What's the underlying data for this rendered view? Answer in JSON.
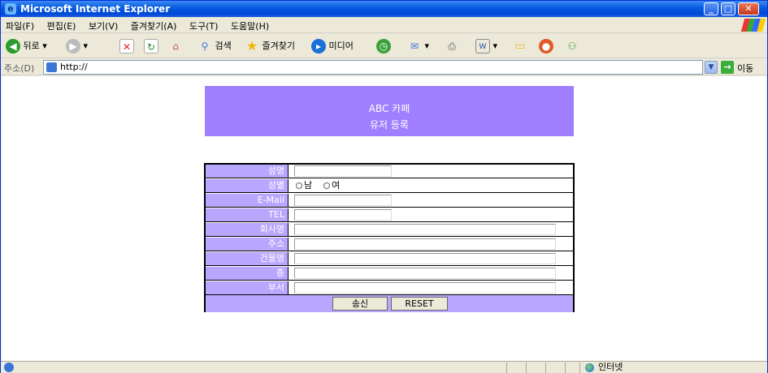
{
  "window": {
    "title": "Microsoft Internet Explorer",
    "ie_glyph": "e"
  },
  "menu": [
    "파일(F)",
    "편집(E)",
    "보기(V)",
    "즐겨찾기(A)",
    "도구(T)",
    "도움말(H)"
  ],
  "toolbar": {
    "back_label": "뒤로",
    "search_label": "검색",
    "favorites_label": "즐겨찾기",
    "media_label": "미디어"
  },
  "address": {
    "label": "주소(D)",
    "value": "http://",
    "go_label": "이동"
  },
  "banner": {
    "line1": "ABC 카페",
    "line2": "유저 등록"
  },
  "form": {
    "fields": [
      {
        "label": "성명"
      },
      {
        "label": "성별",
        "options": [
          "남",
          "여"
        ]
      },
      {
        "label": "E-Mail"
      },
      {
        "label": "TEL"
      },
      {
        "label": "회사명"
      },
      {
        "label": "주소"
      },
      {
        "label": "건물명"
      },
      {
        "label": "층"
      },
      {
        "label": "부서"
      }
    ],
    "submit_label": "송신",
    "reset_label": "RESET"
  },
  "status": {
    "zone": "인터넷"
  },
  "colors": {
    "banner": "#9f7fff",
    "label_cell": "#b9a6ff",
    "titlebar": "#0a5de0"
  }
}
